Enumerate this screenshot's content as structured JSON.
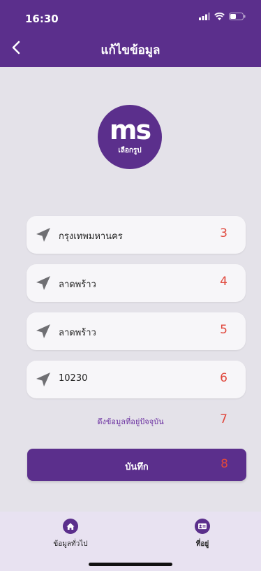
{
  "status": {
    "time": "16:30"
  },
  "header": {
    "title": "แก้ไขข้อมูล"
  },
  "avatar": {
    "initials": "ms",
    "choose_label": "เลือกรูป"
  },
  "fields": [
    {
      "value": "กรุงเทพมหานคร",
      "number": "3"
    },
    {
      "value": "ลาดพร้าว",
      "number": "4"
    },
    {
      "value": "ลาดพร้าว",
      "number": "5"
    },
    {
      "value": "10230",
      "number": "6"
    }
  ],
  "fetch": {
    "label": "ดึงข้อมูลที่อยู่ปัจจุบัน",
    "number": "7"
  },
  "save": {
    "label": "บันทึก",
    "number": "8"
  },
  "tabs": [
    {
      "label": "ข้อมูลทั่วไป",
      "icon": "home-icon"
    },
    {
      "label": "ที่อยู่",
      "icon": "address-card-icon"
    }
  ],
  "colors": {
    "brand": "#5b2f8c",
    "number": "#e0473c",
    "tabbar": "#e8e2f1"
  }
}
